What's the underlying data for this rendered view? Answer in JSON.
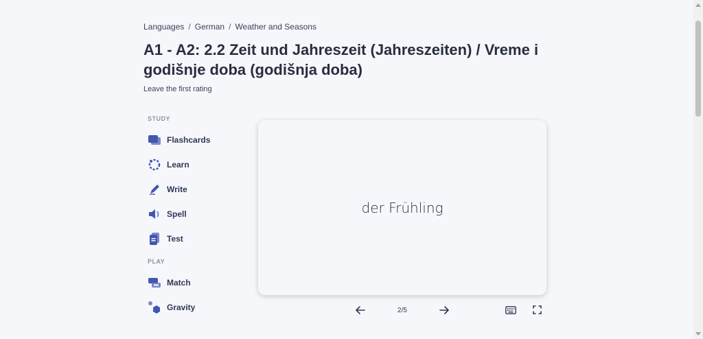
{
  "breadcrumb": [
    {
      "label": "Languages"
    },
    {
      "label": "German"
    },
    {
      "label": "Weather and Seasons"
    }
  ],
  "breadcrumb_separator": "/",
  "title": "A1 - A2: 2.2 Zeit und Jahreszeit (Jahreszeiten) / Vreme i godišnje doba (godišnja doba)",
  "rating_text": "Leave the first rating",
  "study": {
    "label": "STUDY",
    "items": [
      {
        "label": "Flashcards",
        "icon": "flashcards-icon"
      },
      {
        "label": "Learn",
        "icon": "learn-icon"
      },
      {
        "label": "Write",
        "icon": "write-icon"
      },
      {
        "label": "Spell",
        "icon": "spell-icon"
      },
      {
        "label": "Test",
        "icon": "test-icon"
      }
    ]
  },
  "play": {
    "label": "PLAY",
    "items": [
      {
        "label": "Match",
        "icon": "match-icon"
      },
      {
        "label": "Gravity",
        "icon": "gravity-icon"
      }
    ]
  },
  "card": {
    "term": "der Frühling"
  },
  "controls": {
    "counter": "2/5"
  },
  "colors": {
    "accent": "#4257b2",
    "background": "#f6f7fb",
    "text": "#2e3856"
  }
}
